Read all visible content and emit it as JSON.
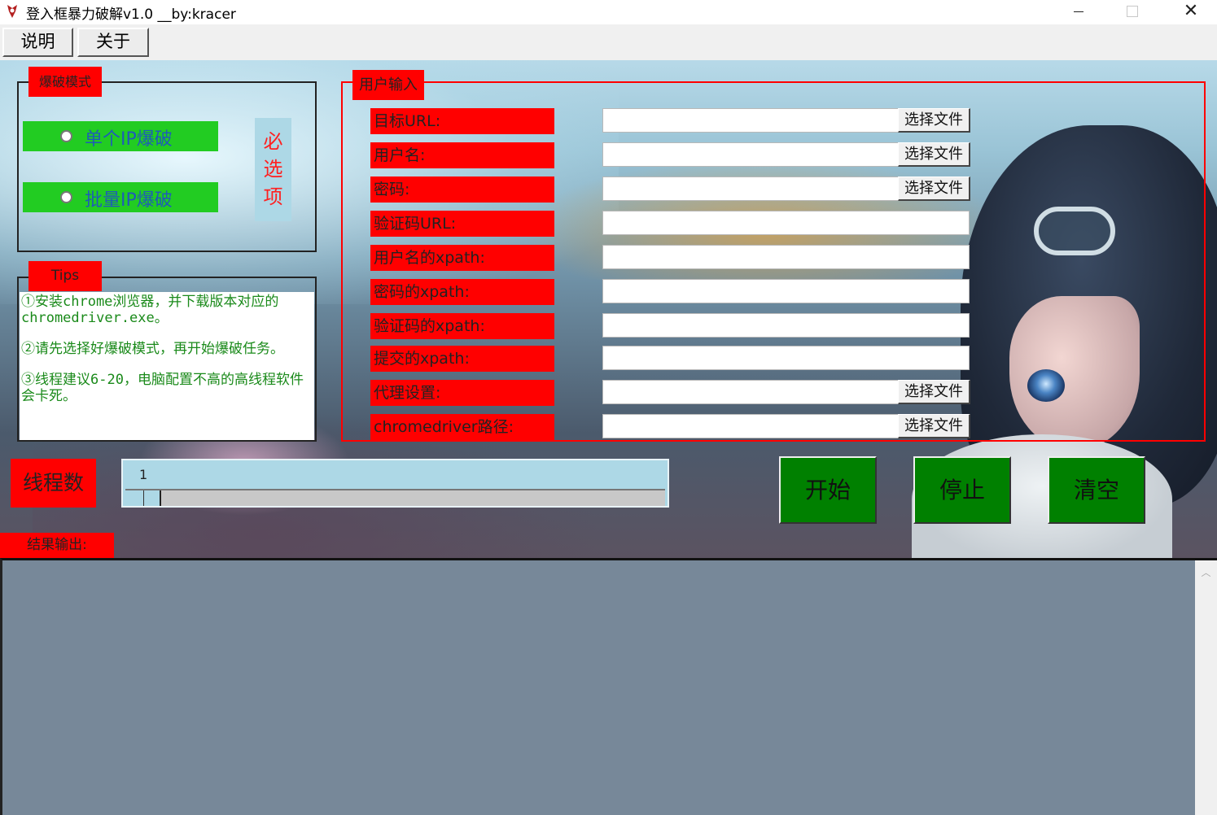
{
  "window": {
    "title": "登入框暴力破解v1.0 __by:kracer",
    "minimize": "",
    "maximize": "",
    "close": "✕"
  },
  "menu": {
    "items": [
      {
        "label": "说明"
      },
      {
        "label": "关于"
      }
    ]
  },
  "mode": {
    "title": "爆破模式",
    "options": [
      {
        "label": "单个IP爆破",
        "selected": false
      },
      {
        "label": "批量IP爆破",
        "selected": false
      }
    ],
    "required": [
      "必",
      "选",
      "项"
    ]
  },
  "tips": {
    "title": "Tips",
    "lines": [
      "①安装chrome浏览器，并下载版本对应的chromedriver.exe。",
      "②请先选择好爆破模式，再开始爆破任务。",
      "③线程建议6-20，电脑配置不高的高线程软件会卡死。"
    ]
  },
  "user_input": {
    "title": "用户输入",
    "fields": [
      {
        "label": "目标URL:",
        "value": "",
        "button": "选择文件"
      },
      {
        "label": "用户名:",
        "value": "",
        "button": "选择文件"
      },
      {
        "label": "密码:",
        "value": "",
        "button": "选择文件"
      },
      {
        "label": "验证码URL:",
        "value": ""
      },
      {
        "label": "用户名的xpath:",
        "value": ""
      },
      {
        "label": "密码的xpath:",
        "value": ""
      },
      {
        "label": "验证码的xpath:",
        "value": ""
      },
      {
        "label": "提交的xpath:",
        "value": ""
      },
      {
        "label": "代理设置:",
        "value": "",
        "button": "选择文件"
      },
      {
        "label": "chromedriver路径:",
        "value": "",
        "button": "选择文件"
      }
    ]
  },
  "threads": {
    "label": "线程数",
    "value": "1"
  },
  "actions": {
    "start": "开始",
    "stop": "停止",
    "clear": "清空"
  },
  "output": {
    "label": "结果输出:",
    "text": ""
  },
  "colors": {
    "label_bg": "#ff0000",
    "radio_bg": "#22cc22",
    "action_bg": "#008000",
    "output_bg": "#778899",
    "slider_bg": "#add8e6"
  }
}
